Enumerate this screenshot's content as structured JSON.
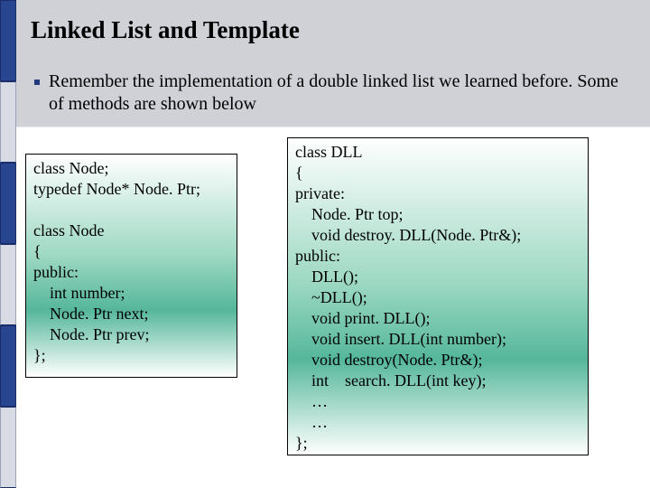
{
  "title": "Linked List and Template",
  "bullet": "Remember the implementation of a double linked list we learned before. Some of methods are shown below",
  "code_left": "class Node;\ntypedef Node* Node. Ptr;\n\nclass Node\n{\npublic:\n    int number;\n    Node. Ptr next;\n    Node. Ptr prev;\n};",
  "code_right": "class DLL\n{\nprivate:\n    Node. Ptr top;\n    void destroy. DLL(Node. Ptr&);\npublic:\n    DLL();\n    ~DLL();\n    void print. DLL();\n    void insert. DLL(int number);\n    void destroy(Node. Ptr&);\n    int    search. DLL(int key);\n    …\n    …\n};"
}
